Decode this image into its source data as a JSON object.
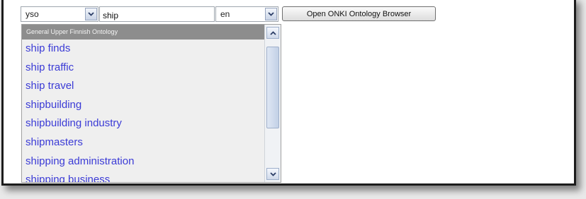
{
  "vocabulary_select": {
    "selected": "yso",
    "arrow_icon": "chevron-down-icon"
  },
  "search": {
    "value": "ship"
  },
  "language_select": {
    "selected": "en",
    "arrow_icon": "chevron-down-icon"
  },
  "browser_button": {
    "label": "Open ONKI Ontology Browser"
  },
  "autocomplete": {
    "group_header": "General Upper Finnish Ontology",
    "suggestions": [
      "ship finds",
      "ship traffic",
      "ship travel",
      "shipbuilding",
      "shipbuilding industry",
      "shipmasters",
      "shipping administration",
      "shipping business"
    ],
    "scroll_position": 0.15
  },
  "colors": {
    "suggestion_text": "#3b3bd6",
    "group_header_bg": "#8d8d8d",
    "list_bg": "#efefef"
  }
}
